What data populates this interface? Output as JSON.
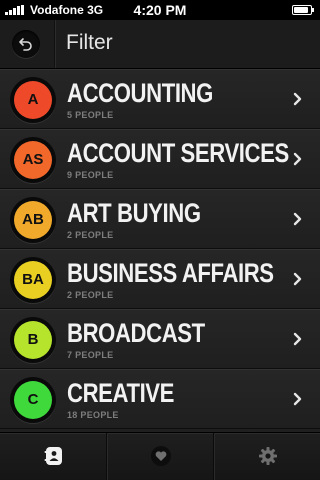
{
  "status_bar": {
    "carrier": "Vodafone 3G",
    "time": "4:20 PM"
  },
  "header": {
    "title": "Filter",
    "back_icon": "back-arrow-icon"
  },
  "items": [
    {
      "initials": "A",
      "name": "ACCOUNTING",
      "count": "5 PEOPLE",
      "color": "#ee4a2a"
    },
    {
      "initials": "AS",
      "name": "ACCOUNT SERVICES",
      "count": "9 PEOPLE",
      "color": "#f2672a"
    },
    {
      "initials": "AB",
      "name": "ART BUYING",
      "count": "2 PEOPLE",
      "color": "#f0a92a"
    },
    {
      "initials": "BA",
      "name": "BUSINESS AFFAIRS",
      "count": "2 PEOPLE",
      "color": "#e8cf22"
    },
    {
      "initials": "B",
      "name": "BROADCAST",
      "count": "7 PEOPLE",
      "color": "#b6e32c"
    },
    {
      "initials": "C",
      "name": "CREATIVE",
      "count": "18 PEOPLE",
      "color": "#3fd93c"
    }
  ],
  "tab_bar": {
    "tabs": [
      {
        "icon": "contacts-icon",
        "active": true
      },
      {
        "icon": "heart-icon",
        "active": false
      },
      {
        "icon": "gear-icon",
        "active": false
      }
    ]
  }
}
